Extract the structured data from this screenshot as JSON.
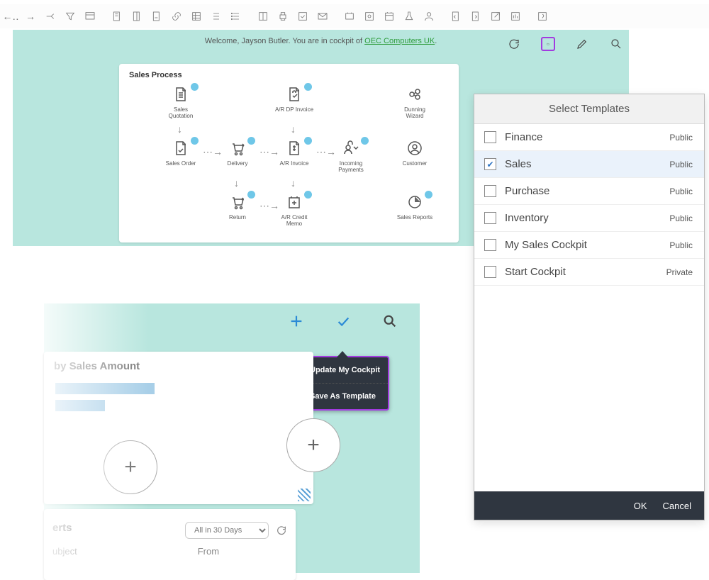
{
  "welcome": {
    "prefix": "Welcome, Jayson Butler. You are in cockpit of ",
    "link_text": "OEC Computers UK",
    "suffix": "."
  },
  "sales_process": {
    "title": "Sales Process",
    "nodes": {
      "sales_quotation": "Sales\nQuotation",
      "ar_dp_invoice": "A/R DP Invoice",
      "sales_order": "Sales Order",
      "delivery": "Delivery",
      "ar_invoice": "A/R Invoice",
      "incoming_payments": "Incoming\nPayments",
      "customer": "Customer",
      "return": "Return",
      "ar_credit_memo": "A/R Credit\nMemo",
      "dunning_wizard": "Dunning\nWizard",
      "sales_reports": "Sales Reports"
    }
  },
  "lower": {
    "chart_title": "by Sales Amount",
    "alerts_title": "erts",
    "alerts_filter": "All in 30 Days",
    "col_subject": "ubject",
    "col_from": "From"
  },
  "popup": {
    "update": "Update My Cockpit",
    "save_as": "Save As Template"
  },
  "dialog": {
    "title": "Select Templates",
    "ok": "OK",
    "cancel": "Cancel",
    "templates": [
      {
        "name": "Finance",
        "visibility": "Public",
        "checked": false
      },
      {
        "name": "Sales",
        "visibility": "Public",
        "checked": true
      },
      {
        "name": "Purchase",
        "visibility": "Public",
        "checked": false
      },
      {
        "name": "Inventory",
        "visibility": "Public",
        "checked": false
      },
      {
        "name": "My Sales Cockpit",
        "visibility": "Public",
        "checked": false
      },
      {
        "name": "Start Cockpit",
        "visibility": "Private",
        "checked": false
      }
    ]
  }
}
